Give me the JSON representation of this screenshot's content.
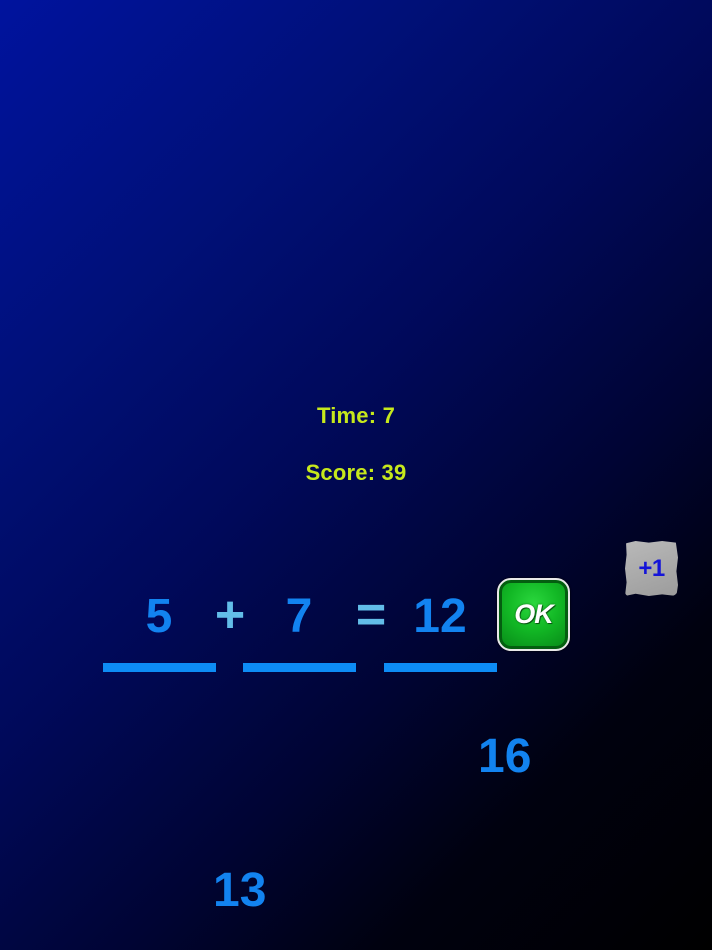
{
  "hud": {
    "time_label": "Time: 7",
    "score_label": "Score: 39"
  },
  "equation": {
    "operand1": "5",
    "operator": "+",
    "operand2": "7",
    "equals": "=",
    "answer": "12"
  },
  "buttons": {
    "ok_label": "OK",
    "bonus_label": "+1"
  },
  "floating_numbers": {
    "first": "16",
    "second": "13"
  },
  "colors": {
    "hud_text": "#c6e81c",
    "number_text": "#1283f0",
    "operator_text": "#62bde8",
    "ok_button": "#12b825",
    "bonus_tile": "#a9a9a9",
    "background_start": "#00139e",
    "background_end": "#000000"
  }
}
